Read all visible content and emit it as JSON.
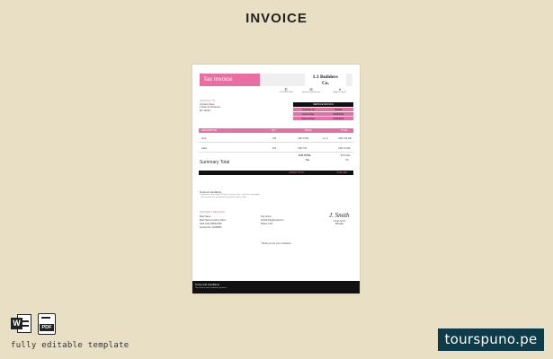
{
  "heading": "INVOICE",
  "invoice": {
    "tax_title": "Tax Invoice",
    "company_line1": "L3 Builders",
    "company_line2": "Co.",
    "contacts": [
      {
        "icon": "phone-icon",
        "glyph": "✆",
        "text": "+1 123 456 7890"
      },
      {
        "icon": "email-icon",
        "glyph": "✉",
        "text": "yourname@email.com"
      },
      {
        "icon": "location-icon",
        "glyph": "⌖",
        "text": "Address City ST"
      }
    ],
    "invoice_to_label": "INVOICE TO",
    "address_lines": [
      "Contact Name",
      "1 Main St, Business,",
      "BC 12345"
    ],
    "details": {
      "header": "SERVICE DETAILS",
      "rows": [
        {
          "label": "Customer ID",
          "value": "000000"
        },
        {
          "label": "Invoice Date",
          "value": "01/05/2022"
        },
        {
          "label": "Payment Due",
          "value": "01/05/2022"
        }
      ]
    },
    "columns": {
      "description": "DESCRIPTION",
      "qty": "QTY",
      "price": "PRICE",
      "total": "TOTAL"
    },
    "items": [
      {
        "description": "Area",
        "qty": "700",
        "price": "USD 3,000",
        "unit": "sq. ft.",
        "total": "USD 700,000"
      },
      {
        "description": "Labor",
        "qty": "100",
        "price": "USD 700",
        "unit": "",
        "total": "USD 70,000"
      }
    ],
    "subtotal_label": "SUB TOTAL",
    "subtotal_value": "$770,000",
    "tax_label": "Tax",
    "tax_value": "7%",
    "summary_label": "Summary Total",
    "grand_label": "GRAND TOTAL",
    "grand_value": "$ 801,800",
    "terms_title": "Terms & Conditions",
    "terms_lines": [
      "• Payment is due within 30 days of invoice date. Late fees may apply.",
      "• This invoice was created on a computer and is valid."
    ],
    "payment_title": "PAYMENT METHOD",
    "payment_left": [
      "Bank Name",
      "Bank Name  Amazing Name",
      "Swift Code  BDHEU438",
      "Account No.  12345839"
    ],
    "payment_right": [
      "Pay Online",
      "PayPal  Pay@email.com",
      "Master Card"
    ],
    "signature": "J. Smith",
    "signer_name": "Jonas Smith",
    "signer_title": "Manager",
    "thanks": "Thank you for your business!",
    "footer_title": "Terms and Conditions",
    "footer_text": "Your Terms and Conditions go here..."
  },
  "icons": {
    "word": "word-file-icon",
    "pdf": "pdf-file-icon",
    "word_letter": "W",
    "pdf_label": "PDF"
  },
  "caption": "fully editable template",
  "brand": "tourspuno.pe"
}
